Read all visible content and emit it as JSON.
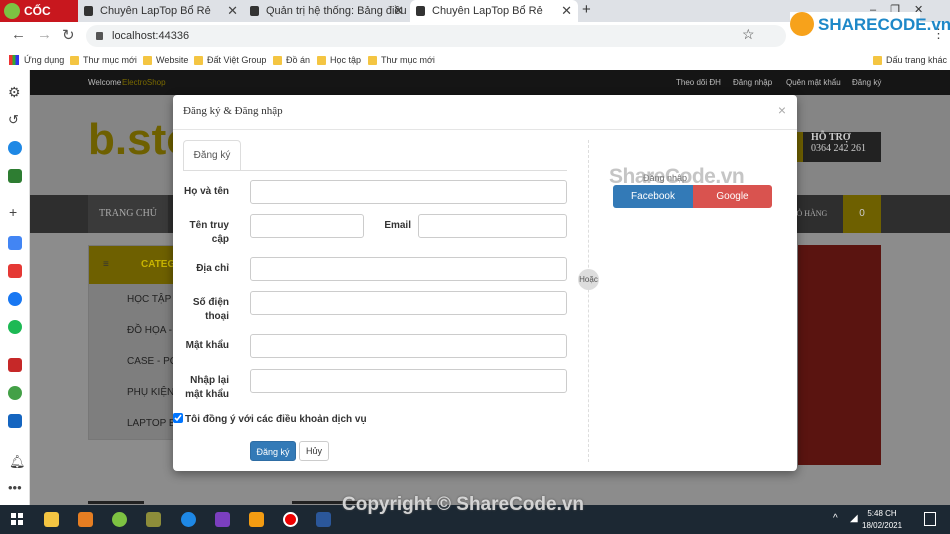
{
  "browser": {
    "brand": "CỐC CỐC",
    "tabs": [
      {
        "title": "Chuyên LapTop Bổ Rẻ",
        "active": false
      },
      {
        "title": "Quản trị hệ thống: Bảng điều",
        "active": false
      },
      {
        "title": "Chuyên LapTop Bổ Rẻ",
        "active": true
      }
    ],
    "new_tab": "+",
    "url": "localhost:44336",
    "bookmarks": [
      "Ứng dụng",
      "Thư mục mới",
      "Website",
      "Đất Việt Group",
      "Đồ án",
      "Học tập",
      "Thư mục mới"
    ],
    "other_bookmarks": "Dấu trang khác"
  },
  "site": {
    "welcome": "Welcome",
    "brand": "ElectroShop",
    "top_links": [
      "Theo dõi ĐH",
      "Đăng nhập",
      "Quên mật khẩu",
      "Đăng ký"
    ],
    "logo_text": "b.sto",
    "support_title": "HỖ TRỢ",
    "support_phone": "0364 242 261",
    "nav_home": "TRANG CHỦ",
    "cart_label": "GIỎ HÀNG",
    "cart_count": "0",
    "category_header": "CATEG",
    "categories": [
      "HỌC TẬP",
      "ĐỒ HỌA -",
      "CASE - PC",
      "PHỤ KIỆN",
      "LAPTOP E"
    ]
  },
  "modal": {
    "title": "Đăng ký & Đăng nhập",
    "close": "×",
    "tab": "Đăng ký",
    "fields": {
      "fullname": "Họ và tên",
      "username": "Tên truy cập",
      "email": "Email",
      "address": "Địa chỉ",
      "phone": "Số điện thoại",
      "password": "Mật khẩu",
      "confirm": "Nhập lại mật khẩu"
    },
    "agree": "Tôi đồng ý với các điều khoản dịch vụ",
    "agree_checked": true,
    "register_btn": "Đăng ký",
    "cancel_btn": "Hủy",
    "or": "Hoặc",
    "login_label": "Đăng nhập",
    "facebook": "Facebook",
    "google": "Google",
    "colors": {
      "facebook": "#337ab7",
      "google": "#d9534f",
      "primary": "#337ab7"
    }
  },
  "watermark": {
    "logo": "SHARECODE.vn",
    "center": "ShareCode.vn",
    "footer": "Copyright © ShareCode.vn"
  },
  "taskbar": {
    "time": "5:48 CH",
    "date": "18/02/2021"
  }
}
